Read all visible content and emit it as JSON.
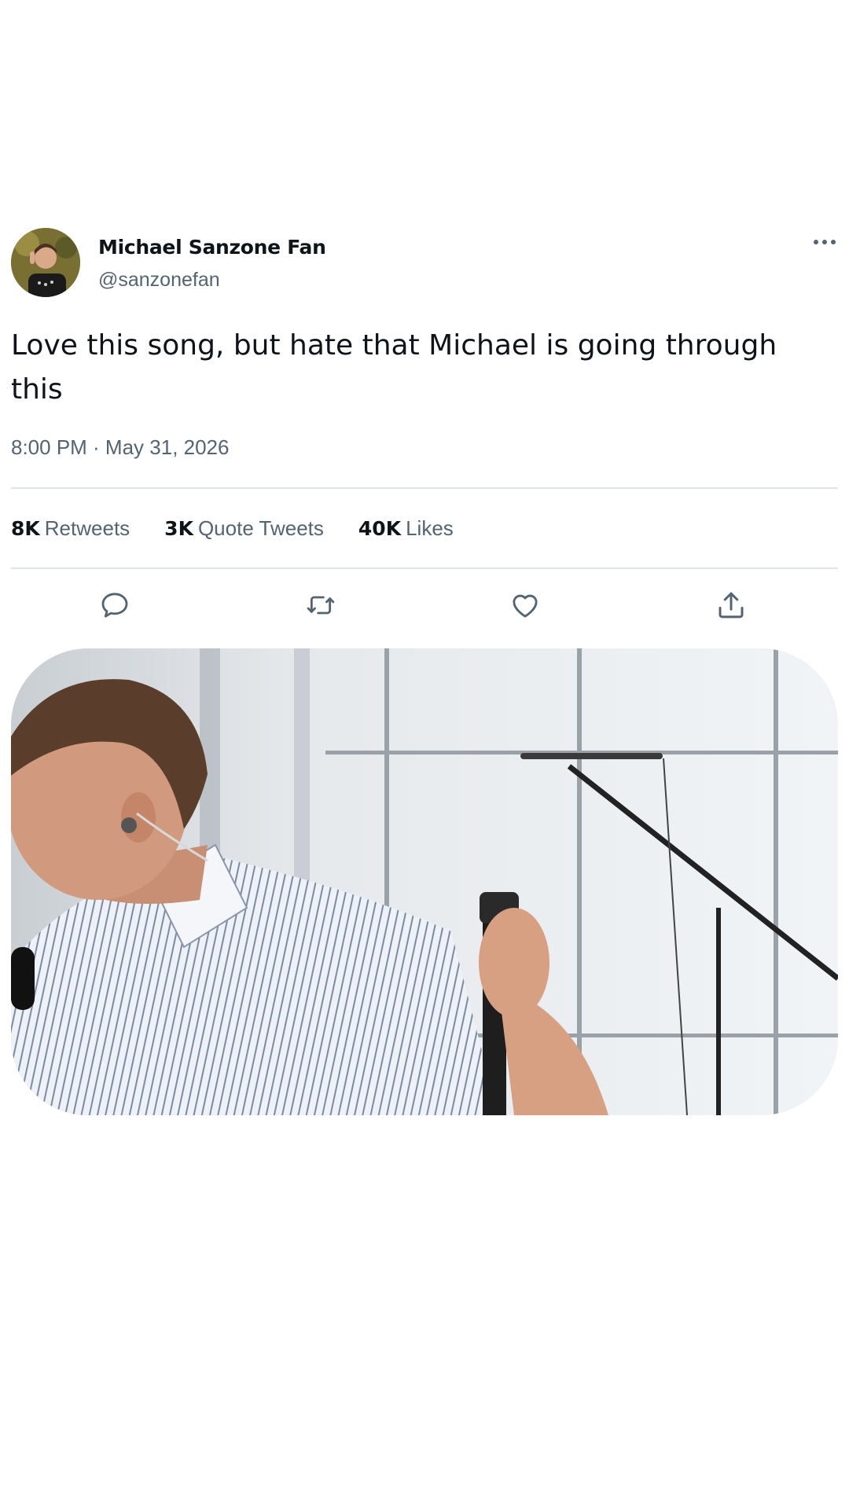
{
  "tweet": {
    "author_name": "Michael Sanzone Fan",
    "author_handle": "@sanzonefan",
    "text": "Love this song, but hate that Michael is going through this",
    "timestamp": "8:00 PM · May 31, 2026",
    "stats": [
      {
        "count": "8K",
        "label": "Retweets"
      },
      {
        "count": "3K",
        "label": "Quote Tweets"
      },
      {
        "count": "40K",
        "label": "Likes"
      }
    ],
    "actions": [
      "reply",
      "retweet",
      "like",
      "share"
    ],
    "media": {
      "kind": "photo",
      "description_icon": "image"
    }
  },
  "colors": {
    "text_primary": "#0f1419",
    "text_secondary": "#536471",
    "divider": "#e1e4e7",
    "background": "#ffffff"
  }
}
